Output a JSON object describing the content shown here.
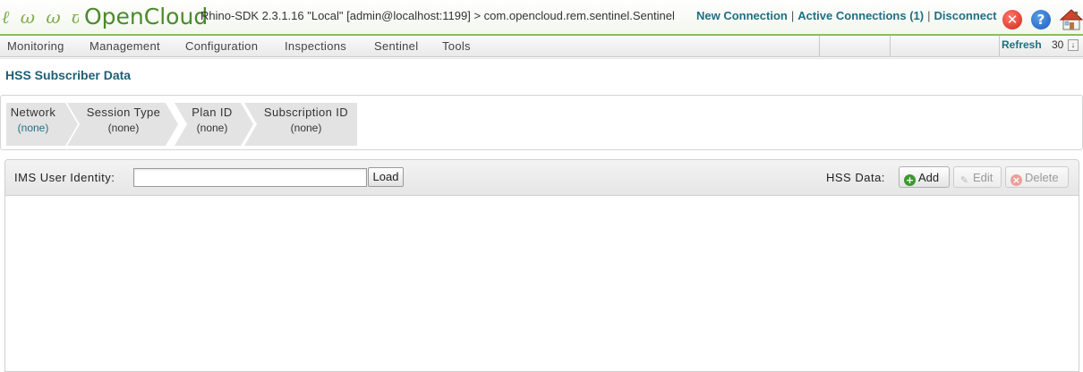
{
  "header": {
    "logo_swirls": "ℓ ω ω ϖ",
    "logo_text": "OpenCloud",
    "connection_info": "Rhino-SDK 2.3.1.16 \"Local\" [admin@localhost:1199] > com.opencloud.rem.sentinel.Sentinel",
    "links": {
      "new_connection": "New Connection",
      "active_connections": "Active Connections (1)",
      "disconnect": "Disconnect"
    },
    "separator": "|",
    "icons": {
      "close": "close-icon",
      "help": "help-icon",
      "home": "home-icon"
    },
    "help_glyph": "?",
    "close_glyph": "✕"
  },
  "menu": {
    "items": [
      "Monitoring",
      "Management",
      "Configuration",
      "Inspections",
      "Sentinel",
      "Tools"
    ],
    "refresh_label": "Refresh",
    "refresh_value": "30",
    "refresh_arrow": "↓"
  },
  "page": {
    "title": "HSS Subscriber Data"
  },
  "filters": [
    {
      "label": "Network",
      "value": "(none)"
    },
    {
      "label": "Session Type",
      "value": "(none)"
    },
    {
      "label": "Plan ID",
      "value": "(none)"
    },
    {
      "label": "Subscription ID",
      "value": "(none)"
    }
  ],
  "identity": {
    "label": "IMS User Identity:",
    "input_value": "",
    "load_label": "Load"
  },
  "hss": {
    "label": "HSS Data:",
    "add_label": "Add",
    "edit_label": "Edit",
    "delete_label": "Delete",
    "add_glyph": "+",
    "delete_glyph": "×",
    "edit_glyph": "✎"
  },
  "colors": {
    "brand_green": "#4b8a2c",
    "link_teal": "#1f6e82",
    "header_border": "#8bbd5d"
  }
}
